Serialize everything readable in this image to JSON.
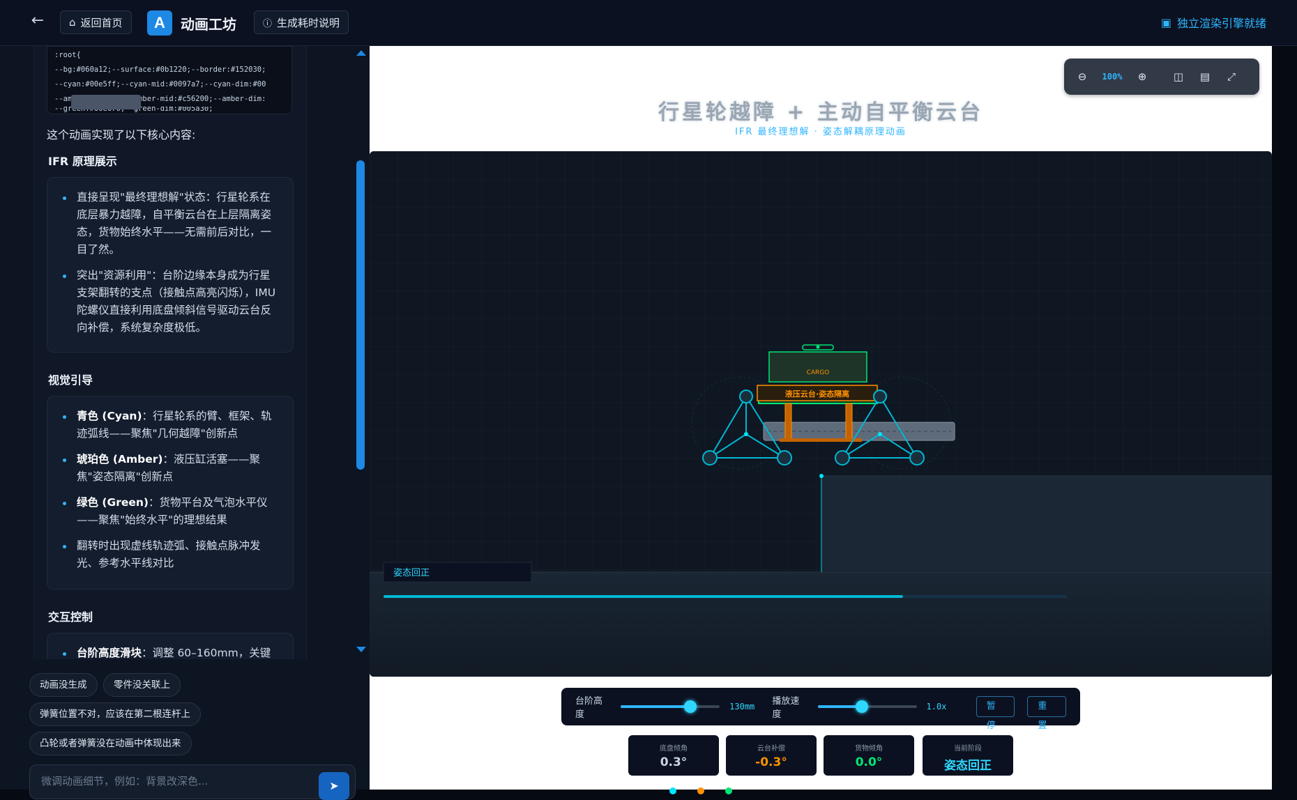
{
  "header": {
    "home_label": "返回首页",
    "logo_letter": "A",
    "app_title": "动画工坊",
    "timing_label": "生成耗时说明",
    "engine_status": "独立渲染引擎就绪"
  },
  "chat": {
    "code_lines": [
      ":root{",
      "  --bg:#060a12;--surface:#0b1220;--border:#152030;",
      "  --cyan:#00e5ff;--cyan-mid:#0097a7;--cyan-dim:#00",
      "  --amber:#ff9100;--amber-mid:#c56200;--amber-dim:",
      "  --green:#00e676;--green-dim:#005a30;"
    ],
    "intro": "这个动画实现了以下核心内容:",
    "sections": [
      {
        "title": "IFR 原理展示",
        "items": [
          "直接呈现\"最终理想解\"状态：行星轮系在底层暴力越障，自平衡云台在上层隔离姿态，货物始终水平——无需前后对比，一目了然。",
          "突出\"资源利用\"：台阶边缘本身成为行星支架翻转的支点（接触点高亮闪烁），IMU 陀螺仪直接利用底盘倾斜信号驱动云台反向补偿，系统复杂度极低。"
        ]
      },
      {
        "title": "视觉引导",
        "items": [
          {
            "bold": "青色 (Cyan)",
            "text": "：行星轮系的臂、框架、轨迹弧线——聚焦\"几何越障\"创新点"
          },
          {
            "bold": "琥珀色 (Amber)",
            "text": "：液压缸活塞——聚焦\"姿态隔离\"创新点"
          },
          {
            "bold": "绿色 (Green)",
            "text": "：货物平台及气泡水平仪——聚焦\"始终水平\"的理想结果"
          },
          {
            "bold": "",
            "text": "翻转时出现虚线轨迹弧、接触点脉冲发光、参考水平线对比"
          }
        ]
      },
      {
        "title": "交互控制",
        "items": [
          {
            "bold": "台阶高度滑块",
            "text": "：调整 60–160mm，关键"
          }
        ]
      }
    ],
    "suggestions": [
      "动画没生成",
      "零件没关联上",
      "弹簧位置不对，应该在第二根连杆上",
      "凸轮或者弹簧没在动画中体现出来"
    ],
    "input_placeholder": "微调动画细节，例如：背景改深色..."
  },
  "stage": {
    "title": "行星轮越障 + 主动自平衡云台",
    "subtitle": "IFR 最终理想解 · 姿态解耦原理动画",
    "zoom": "100%",
    "cargo_label": "CARGO",
    "gimbal_label": "液压云台·姿态隔离",
    "phase_banner": "姿态回正",
    "progress": 0.76,
    "controls": {
      "step_label": "台阶高度",
      "step_value": "130mm",
      "step_fraction": 0.7,
      "speed_label": "播放速度",
      "speed_value": "1.0x",
      "speed_fraction": 0.45,
      "pause_label": "暂停",
      "reset_label": "重置"
    },
    "stats": [
      {
        "label": "底盘倾角",
        "value": "0.3°",
        "color": "#c9d6e6"
      },
      {
        "label": "云台补偿",
        "value": "-0.3°",
        "color": "#ff9100"
      },
      {
        "label": "货物倾角",
        "value": "0.0°",
        "color": "#00e676"
      },
      {
        "label": "当前阶段",
        "value": "姿态回正",
        "color": "#2fd6ff"
      }
    ]
  },
  "colors": {
    "cyan": "#00e5ff",
    "amber": "#ff9100",
    "green": "#00e676",
    "accent": "#1e88e5"
  }
}
